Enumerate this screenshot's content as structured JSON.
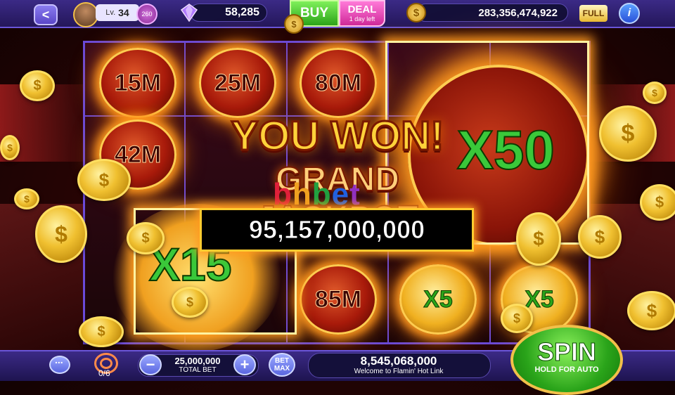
{
  "header": {
    "back_icon": "<",
    "level_prefix": "Lv.",
    "level": "34",
    "level_badge": "260",
    "gems": "58,285",
    "buy_label": "BUY",
    "deal_label": "DEAL",
    "deal_timer": "1 day left",
    "coins": "283,356,474,922",
    "full_label": "FULL",
    "info_label": "i",
    "coin_symbol": "$"
  },
  "reels": {
    "values": [
      "15M",
      "25M",
      "80M",
      "42M",
      "85M",
      "X5",
      "X5"
    ],
    "big_multiplier": "X50",
    "left_multiplier": "X15"
  },
  "win": {
    "headline": "YOU WON!",
    "subtitle": "GRAND JACKPOT",
    "amount": "95,157,000,000",
    "watermark": [
      "b",
      "h",
      "b",
      "e",
      "t"
    ]
  },
  "footer": {
    "target_count": "0/6",
    "total_bet": "25,000,000",
    "total_bet_label": "TOTAL BET",
    "minus_label": "−",
    "plus_label": "+",
    "bet_max_line1": "BET",
    "bet_max_line2": "MAX",
    "balance": "8,545,068,000",
    "welcome_text": "Welcome to Flamin' Hot Link",
    "spin_label": "SPIN",
    "spin_sub": "HOLD FOR AUTO"
  },
  "colors": {
    "accent": "#6a55d8",
    "buy": "#2aa41a",
    "deal": "#d0299a",
    "jackpot_gold": "#ffd23a"
  }
}
